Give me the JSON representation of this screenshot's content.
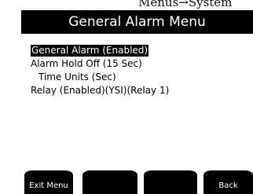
{
  "breadcrumb": "Menus→System",
  "title": "General Alarm Menu",
  "menu": {
    "items": [
      "General Alarm (Enabled)",
      "Alarm Hold Off (15 Sec)",
      "Time Units (Sec)",
      "Relay (Enabled)(YSI)(Relay 1)"
    ]
  },
  "softkeys": [
    "Exit Menu",
    "",
    "",
    "Back"
  ],
  "colors": {
    "screen_bg": "#ffffff",
    "title_bg": "#000000",
    "title_text": "#ffffff",
    "selection_bg": "#000000",
    "softkey_bg": "#000000"
  }
}
